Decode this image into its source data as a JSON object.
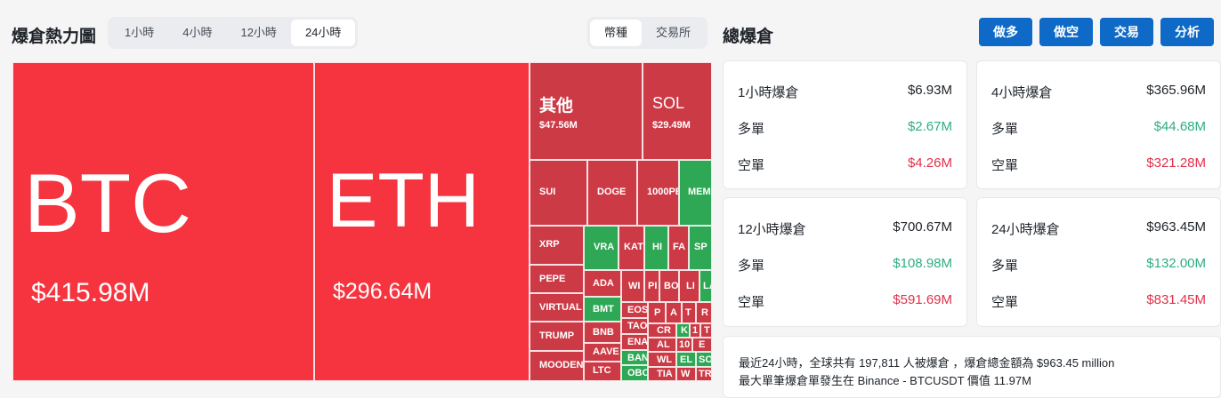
{
  "heatmap": {
    "title": "爆倉熱力圖",
    "time_tabs": [
      "1小時",
      "4小時",
      "12小時",
      "24小時"
    ],
    "active_time_tab": "24小時",
    "group_tabs": [
      "幣種",
      "交易所"
    ],
    "active_group_tab": "幣種",
    "tiles": {
      "btc": {
        "label": "BTC",
        "value": "$415.98M"
      },
      "eth": {
        "label": "ETH",
        "value": "$296.64M"
      },
      "other": {
        "label": "其他",
        "value": "$47.56M"
      },
      "sol": {
        "label": "SOL",
        "value": "$29.49M"
      },
      "sui": "SUI",
      "doge": "DOGE",
      "k1000pepe": "1000PE",
      "meme": "MEM",
      "xrp": "XRP",
      "vra": "VRA",
      "kat": "KAT",
      "hi": "HI",
      "fa": "FA",
      "sp": "SP",
      "pepe": "PEPE",
      "ada": "ADA",
      "wi": "WI",
      "pi": "PI",
      "bo": "BO",
      "li": "LI",
      "la": "LA",
      "virtual": "VIRTUAL",
      "bmt": "BMT",
      "eos": "EOS",
      "p": "P",
      "a": "A",
      "t2": "T",
      "r": "R",
      "trump": "TRUMP",
      "bnb": "BNB",
      "tao": "TAO",
      "cr": "CR",
      "k": "K",
      "one": "1",
      "tt": "T",
      "mooden": "MOODEN",
      "aave": "AAVE",
      "ena": "ENA",
      "al": "AL",
      "ten": "10",
      "ee": "E",
      "ltc": "LTC",
      "ban": "BAN",
      "wl": "WL",
      "el": "EL",
      "so": "SO",
      "obo": "OBO",
      "tia": "TIA",
      "w": "W",
      "tr": "TR"
    }
  },
  "summary": {
    "title": "總爆倉",
    "actions": [
      "做多",
      "做空",
      "交易",
      "分析"
    ],
    "cards": [
      {
        "title": "1小時爆倉",
        "total": "$6.93M",
        "long_label": "多單",
        "long": "$2.67M",
        "short_label": "空單",
        "short": "$4.26M"
      },
      {
        "title": "4小時爆倉",
        "total": "$365.96M",
        "long_label": "多單",
        "long": "$44.68M",
        "short_label": "空單",
        "short": "$321.28M"
      },
      {
        "title": "12小時爆倉",
        "total": "$700.67M",
        "long_label": "多單",
        "long": "$108.98M",
        "short_label": "空單",
        "short": "$591.69M"
      },
      {
        "title": "24小時爆倉",
        "total": "$963.45M",
        "long_label": "多單",
        "long": "$132.00M",
        "short_label": "空單",
        "short": "$831.45M"
      }
    ],
    "info_line1": "最近24小時，全球共有 197,811 人被爆倉 ，爆倉總金額為 $963.45 million",
    "info_line2": "最大單筆爆倉單發生在 Binance - BTCUSDT 價值 11.97M"
  },
  "colors": {
    "liq_red": "#f6343f",
    "liq_dark_red": "#cc3a46",
    "liq_green": "#2ea855",
    "action_blue": "#0e6ac6",
    "long_green": "#2ead83",
    "short_red": "#e0314b"
  }
}
